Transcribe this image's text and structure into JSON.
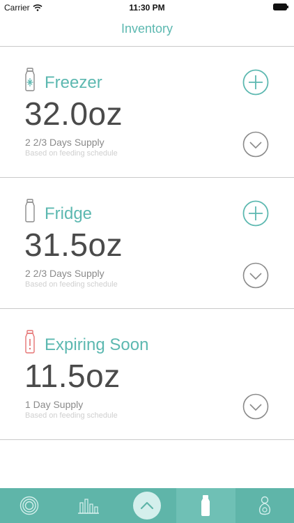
{
  "status_bar": {
    "carrier": "Carrier",
    "time": "11:30 PM"
  },
  "header": {
    "title": "Inventory"
  },
  "colors": {
    "accent": "#5cb8b0",
    "alert": "#e57373",
    "tabbar": "#5fb5a9"
  },
  "sections": [
    {
      "title": "Freezer",
      "amount": "32.0oz",
      "supply": "2 2/3 Days Supply",
      "basis": "Based on feeding schedule",
      "icon": "freezer-bottle-icon"
    },
    {
      "title": "Fridge",
      "amount": "31.5oz",
      "supply": "2 2/3 Days Supply",
      "basis": "Based on feeding schedule",
      "icon": "fridge-bottle-icon"
    },
    {
      "title": "Expiring Soon",
      "amount": "11.5oz",
      "supply": "1 Day Supply",
      "basis": "Based on feeding schedule",
      "icon": "expiring-bottle-icon"
    }
  ],
  "tabs": [
    {
      "icon": "target-icon"
    },
    {
      "icon": "bar-chart-icon"
    },
    {
      "icon": "chevron-up-icon"
    },
    {
      "icon": "bottle-icon"
    },
    {
      "icon": "mother-baby-icon"
    }
  ]
}
